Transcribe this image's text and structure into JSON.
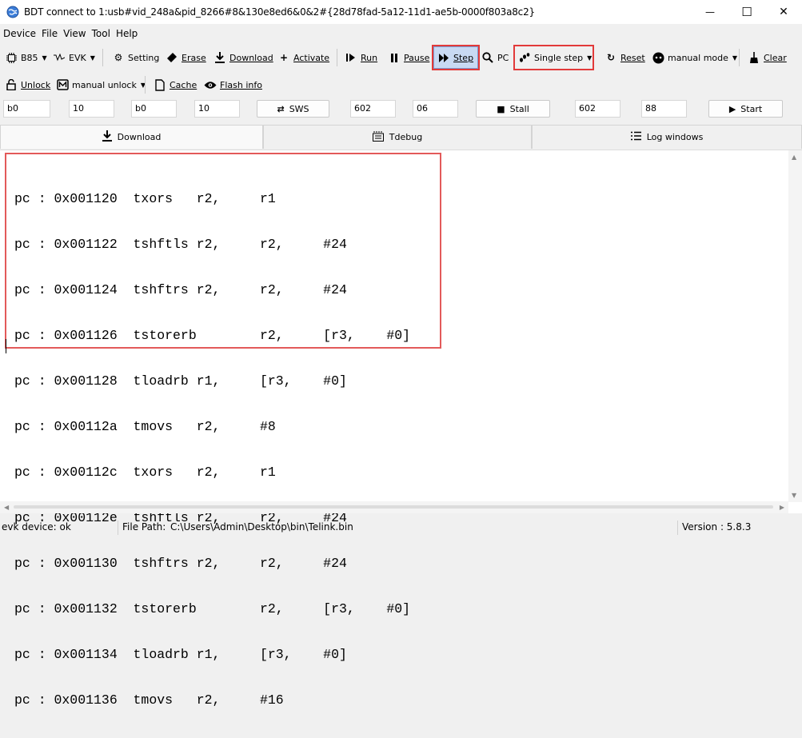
{
  "window": {
    "title": "BDT connect to 1:usb#vid_248a&pid_8266#8&130e8ed6&0&2#{28d78fad-5a12-11d1-ae5b-0000f803a8c2}",
    "minimize": "—",
    "maximize": "☐",
    "close": "✕"
  },
  "menu": [
    "Device",
    "File",
    "View",
    "Tool",
    "Help"
  ],
  "toolbar1": {
    "chip": "B85",
    "board": "EVK",
    "setting": "Setting",
    "erase": "Erase",
    "download": "Download",
    "activate": "Activate",
    "run": "Run",
    "pause": "Pause",
    "step": "Step",
    "pc": "PC",
    "single_step": "Single step",
    "reset": "Reset",
    "manual_mode": "manual mode",
    "clear": "Clear"
  },
  "toolbar2": {
    "unlock": "Unlock",
    "manual_unlock": "manual unlock",
    "cache": "Cache",
    "flash_info": "Flash info"
  },
  "inputs": {
    "f1": "b0",
    "f2": "10",
    "f3": "b0",
    "f4": "10",
    "sws": "SWS",
    "f5": "602",
    "f6": "06",
    "stall": "Stall",
    "f7": "602",
    "f8": "88",
    "start": "Start"
  },
  "tabs": [
    "Download",
    "Tdebug",
    "Log windows"
  ],
  "code_lines": [
    "pc : 0x001120  txors   r2,     r1",
    "pc : 0x001122  tshftls r2,     r2,     #24",
    "pc : 0x001124  tshftrs r2,     r2,     #24",
    "pc : 0x001126  tstorerb        r2,     [r3,    #0]",
    "pc : 0x001128  tloadrb r1,     [r3,    #0]",
    "pc : 0x00112a  tmovs   r2,     #8",
    "pc : 0x00112c  txors   r2,     r1",
    "pc : 0x00112e  tshftls r2,     r2,     #24",
    "pc : 0x001130  tshftrs r2,     r2,     #24",
    "pc : 0x001132  tstorerb        r2,     [r3,    #0]",
    "pc : 0x001134  tloadrb r1,     [r3,    #0]",
    "pc : 0x001136  tmovs   r2,     #16"
  ],
  "status": {
    "device": "evk device: ok",
    "file_path_label": "File Path:",
    "file_path": "C:\\Users\\Admin\\Desktop\\bin\\Telink.bin",
    "version": "Version : 5.8.3"
  },
  "colors": {
    "highlight": "#e23a3a",
    "step_bg": "#c8d9f3"
  }
}
